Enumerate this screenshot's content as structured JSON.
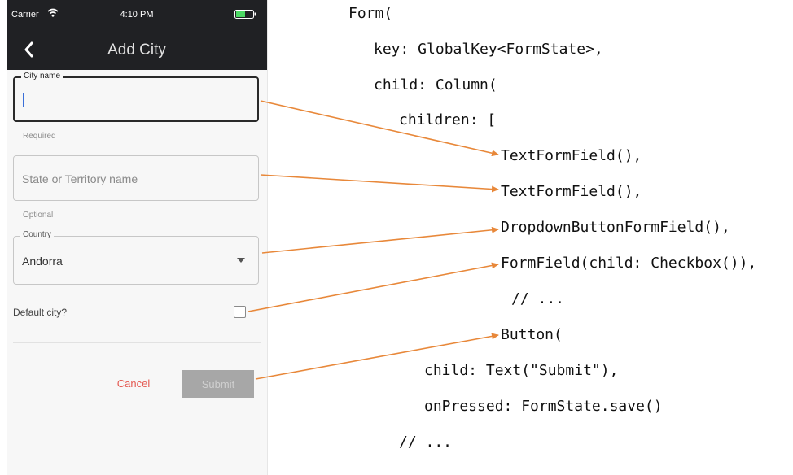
{
  "phone": {
    "status": {
      "carrier": "Carrier",
      "time": "4:10 PM"
    },
    "appbar": {
      "back_icon": "chevron-left-icon",
      "title": "Add City"
    },
    "city_field": {
      "label": "City name",
      "helper": "Required"
    },
    "state_field": {
      "placeholder": "State or Territory name",
      "helper": "Optional"
    },
    "country_field": {
      "label": "Country",
      "value": "Andorra",
      "icon": "dropdown-arrow-icon"
    },
    "default_city": {
      "label": "Default city?"
    },
    "buttons": {
      "cancel": "Cancel",
      "submit": "Submit"
    }
  },
  "code": {
    "lines": [
      "Form(",
      "key: GlobalKey<FormState>,",
      "child: Column(",
      "children: [",
      "TextFormField(),",
      "TextFormField(),",
      "DropdownButtonFormField(),",
      "FormField(child: Checkbox()),",
      "// ...",
      "Button(",
      "child: Text(\"Submit\"),",
      "onPressed: FormState.save()",
      "// ..."
    ]
  },
  "colors": {
    "arrow": "#e8883a",
    "appbar": "#202124",
    "cancel": "#e45a52",
    "submit_bg": "#a7a7a7"
  }
}
